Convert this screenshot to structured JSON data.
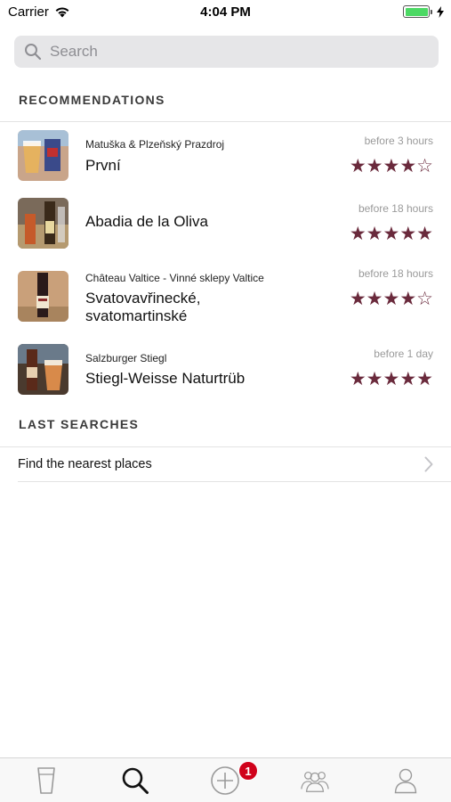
{
  "status_bar": {
    "carrier": "Carrier",
    "time": "4:04 PM",
    "wifi_icon": "wifi-icon",
    "battery_icon": "battery-icon",
    "charging_icon": "bolt-icon",
    "battery_color": "#4cd964"
  },
  "search": {
    "placeholder": "Search",
    "icon": "search-icon"
  },
  "recommendations": {
    "header": "RECOMMENDATIONS",
    "star_color": "#6a2a3c",
    "items": [
      {
        "subtitle": "Matuška & Plzeňský Prazdroj",
        "title": "První",
        "time": "before 3 hours",
        "rating": 4,
        "max_rating": 5,
        "stars": "★★★★☆"
      },
      {
        "subtitle": "",
        "title": "Abadia de la Oliva",
        "time": "before 18 hours",
        "rating": 5,
        "max_rating": 5,
        "stars": "★★★★★"
      },
      {
        "subtitle": "Château Valtice - Vinné sklepy Valtice",
        "title": "Svatovavřinecké,\nsvatomartinské",
        "title_line1": "Svatovavřinecké,",
        "title_line2": "svatomartinské",
        "time": "before 18 hours",
        "rating": 4,
        "max_rating": 5,
        "stars": "★★★★☆"
      },
      {
        "subtitle": "Salzburger Stiegl",
        "title": "Stiegl-Weisse Naturtrüb",
        "time": "before 1 day",
        "rating": 5,
        "max_rating": 5,
        "stars": "★★★★★"
      }
    ]
  },
  "last_searches": {
    "header": "LAST SEARCHES",
    "items": [
      {
        "label": "Find the nearest places",
        "icon": "chevron-right-icon"
      }
    ]
  },
  "tab_bar": {
    "tabs": [
      {
        "name": "beer-glass-icon"
      },
      {
        "name": "search-icon",
        "active": true
      },
      {
        "name": "add-circle-icon",
        "badge": "1"
      },
      {
        "name": "friends-icon"
      },
      {
        "name": "profile-icon"
      }
    ],
    "badge_color": "#d0021b"
  }
}
